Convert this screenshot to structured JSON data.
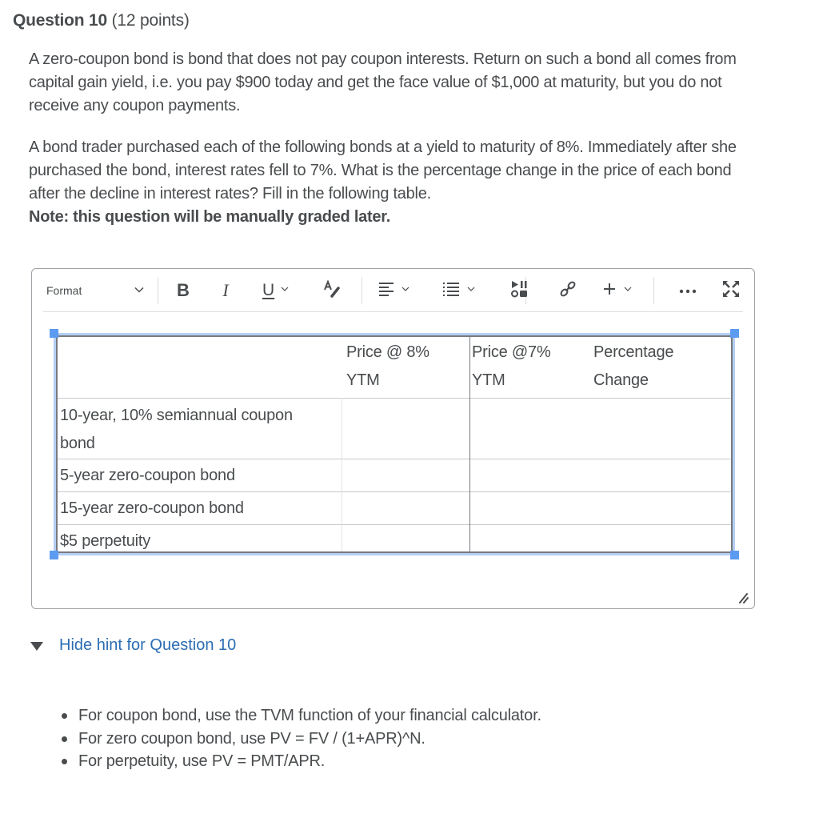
{
  "question": {
    "title_bold": "Question 10",
    "points": "(12 points)",
    "paragraph1": "A zero-coupon bond is bond that does not pay coupon interests. Return on such a bond all comes from capital gain yield, i.e. you pay $900 today and get the face value of $1,000 at maturity, but you do not receive any coupon payments.",
    "paragraph2": "A bond trader purchased each of the following bonds at a yield to maturity of 8%. Immediately after she purchased the bond, interest rates fell to 7%. What is the percentage change in the price of each bond after the decline in interest rates? Fill in the following table.",
    "note": "Note: this question will be manually graded later."
  },
  "toolbar": {
    "format_label": "Format",
    "buttons": [
      {
        "name": "bold",
        "glyph": "B"
      },
      {
        "name": "italic",
        "glyph": "I"
      },
      {
        "name": "underline",
        "glyph": "U"
      }
    ]
  },
  "table": {
    "headers": [
      "",
      "Price @ 8%\nYTM",
      "Price @7%\nYTM",
      "Percentage\nChange"
    ],
    "header_lines": {
      "price8_l1": "Price @ 8%",
      "price8_l2": "YTM",
      "price7_l1": "Price @7%",
      "price7_l2": "YTM",
      "pct_l1": "Percentage",
      "pct_l2": "Change"
    },
    "rows": [
      {
        "label_l1": "10-year, 10% semiannual coupon",
        "label_l2": "bond",
        "price8": "",
        "price7": "",
        "pct": ""
      },
      {
        "label_l1": "5-year zero-coupon bond",
        "price8": "",
        "price7": "",
        "pct": ""
      },
      {
        "label_l1": "15-year zero-coupon bond",
        "price8": "",
        "price7": "",
        "pct": ""
      },
      {
        "label_l1": "$5 perpetuity",
        "price8": "",
        "price7": "",
        "pct": ""
      }
    ]
  },
  "hint": {
    "toggle_label": "Hide hint for Question 10",
    "items": [
      "For coupon bond, use the TVM function of your financial calculator.",
      "For zero coupon bond, use PV = FV / (1+APR)^N.",
      "For perpetuity, use PV = PMT/APR."
    ]
  },
  "colors": {
    "text": "#494c4e",
    "link": "#2c6db3",
    "selection_handle": "#5c9bf2",
    "selection_border": "#b5cff5"
  }
}
